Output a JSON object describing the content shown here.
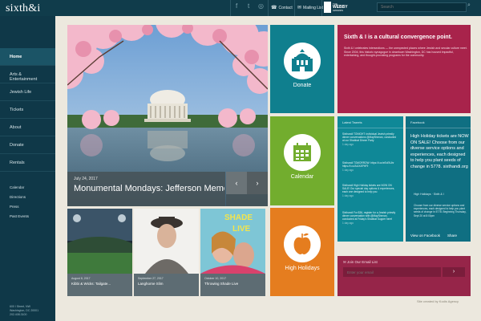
{
  "header": {
    "logo": "sixth&i",
    "social": [
      "facebook-icon",
      "twitter-icon",
      "instagram-icon",
      "video-icon"
    ],
    "contact_label": "Contact",
    "mailing_label": "Mailing List",
    "webby_small": "THE",
    "webby_big": "WEBBY",
    "webby_sub": "AWARDS",
    "search_placeholder": "Search"
  },
  "sidebar": {
    "items": [
      {
        "label": "Home",
        "active": true
      },
      {
        "label": "Arts & Entertainment"
      },
      {
        "label": "Jewish Life"
      },
      {
        "label": "Tickets"
      },
      {
        "label": "About"
      },
      {
        "label": "Donate"
      },
      {
        "label": "Rentals"
      }
    ],
    "sub_items": [
      "Calendar",
      "Directions",
      "Press",
      "Past Events"
    ],
    "address": [
      "600 I Street, NW",
      "Washington, DC 20001",
      "202.408.3100"
    ]
  },
  "hero": {
    "date": "July 24, 2017",
    "title": "Monumental Mondays: Jefferson Memorial",
    "prev": "‹",
    "next": "›"
  },
  "thumbs": [
    {
      "date": "August 8, 2017",
      "title": "Kibbi & Wicks: Tailgate..."
    },
    {
      "date": "September 27, 2017",
      "title": "Langhorne Slim"
    },
    {
      "date": "October 10, 2017",
      "title": "Throwing Shade Live"
    }
  ],
  "tiles": {
    "donate": "Donate",
    "calendar": "Calendar",
    "holidays": "High Holidays"
  },
  "headline": {
    "title": "Sixth & I is a cultural convergence point.",
    "body": "Sixth & I celebrates intersections — the unexpected places where Jewish and secular culture meet. Since 2004, this historic synagogue in downtown Washington, DC has housed impactful, entertaining, and thought-provoking programs for the community."
  },
  "tweets": {
    "heading": "Latest Tweets",
    "items": [
      {
        "text": "Sixthandi TONIGHT: individual Jewish priestly dinner conversations @MayShenan, conducted at our Shabbat Dinner Party",
        "time": "1 day ago"
      },
      {
        "text": "Sixthandi TOMORROW: https://t.co/eEcEtUhr https://t.co/ALtXAPhF9",
        "time": "1 day ago"
      },
      {
        "text": "Sixthandi High Holiday tickets are NOW ON SALE! Our special day options & experiences, each one designed to help you",
        "time": "1 day ago"
      },
      {
        "text": "Sixthandi For $36, register for a Jewish priestly dinner conversation with @MayShenan, conducted at Friday's Shabbat Supper here!",
        "time": "1 day ago"
      }
    ]
  },
  "facebook": {
    "heading": "Facebook",
    "lead": "High Holiday tickets are NOW ON SALE! Choose from our diverse service options and experiences, each designed to help you plant seeds of change in 5778. sixthandi.org",
    "author": "High Holidays · Sixth & I",
    "body": "Choose from our diverse service options and experiences, each designed to help you plant seeds of change in 5778. Beginning Thursday, Sept 20 at 8:00pm",
    "view": "View on Facebook",
    "share": "Share"
  },
  "email": {
    "heading": "Join Our Email List",
    "placeholder": "Enter your email",
    "submit": "›"
  },
  "footer": {
    "credit": "Site created by Kodis Agency"
  },
  "colors": {
    "topbar": "#103c4b",
    "donate": "#0f7f8e",
    "headline": "#a8234b",
    "calendar": "#72ad2e",
    "holidays": "#e57d1f",
    "email": "#962549"
  }
}
